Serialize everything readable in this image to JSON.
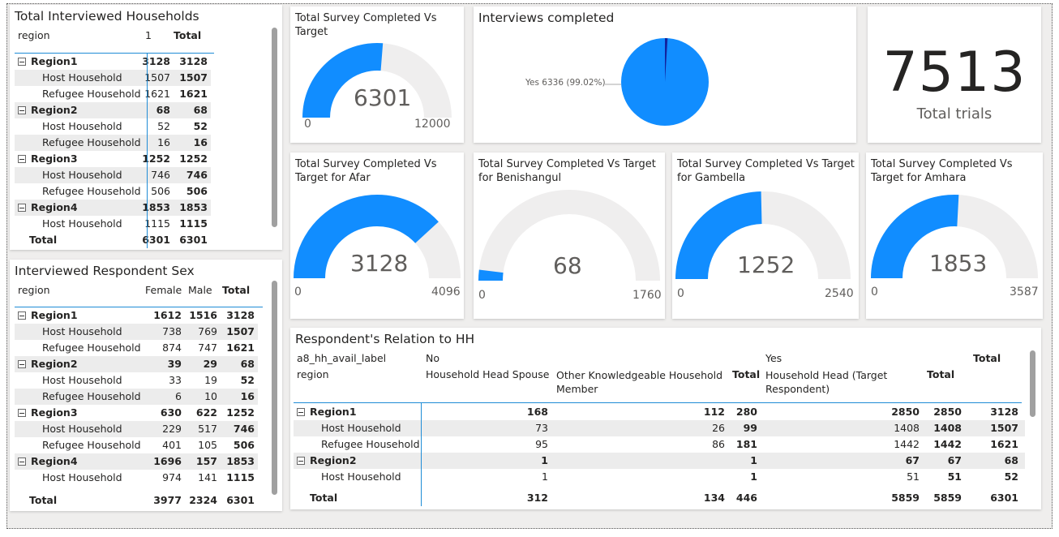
{
  "colors": {
    "accent": "#118dff",
    "track": "#efeeee",
    "dark": "#12239e"
  },
  "households": {
    "title": "Total Interviewed Households",
    "headers": [
      "region",
      "1",
      "Total"
    ],
    "rows": [
      {
        "label": "Region1",
        "v1": "3128",
        "total": "3128",
        "level": 0
      },
      {
        "label": "Host Household",
        "v1": "1507",
        "total": "1507",
        "level": 1
      },
      {
        "label": "Refugee Household",
        "v1": "1621",
        "total": "1621",
        "level": 1
      },
      {
        "label": "Region2",
        "v1": "68",
        "total": "68",
        "level": 0
      },
      {
        "label": "Host Household",
        "v1": "52",
        "total": "52",
        "level": 1
      },
      {
        "label": "Refugee Household",
        "v1": "16",
        "total": "16",
        "level": 1
      },
      {
        "label": "Region3",
        "v1": "1252",
        "total": "1252",
        "level": 0
      },
      {
        "label": "Host Household",
        "v1": "746",
        "total": "746",
        "level": 1
      },
      {
        "label": "Refugee Household",
        "v1": "506",
        "total": "506",
        "level": 1
      },
      {
        "label": "Region4",
        "v1": "1853",
        "total": "1853",
        "level": 0
      },
      {
        "label": "Host Household",
        "v1": "1115",
        "total": "1115",
        "level": 1
      }
    ],
    "total": {
      "label": "Total",
      "v1": "6301",
      "total": "6301"
    }
  },
  "sex": {
    "title": "Interviewed Respondent Sex",
    "headers": [
      "region",
      "Female",
      "Male",
      "Total"
    ],
    "rows": [
      {
        "label": "Region1",
        "f": "1612",
        "m": "1516",
        "t": "3128",
        "level": 0
      },
      {
        "label": "Host Household",
        "f": "738",
        "m": "769",
        "t": "1507",
        "level": 1
      },
      {
        "label": "Refugee Household",
        "f": "874",
        "m": "747",
        "t": "1621",
        "level": 1
      },
      {
        "label": "Region2",
        "f": "39",
        "m": "29",
        "t": "68",
        "level": 0
      },
      {
        "label": "Host Household",
        "f": "33",
        "m": "19",
        "t": "52",
        "level": 1
      },
      {
        "label": "Refugee Household",
        "f": "6",
        "m": "10",
        "t": "16",
        "level": 1
      },
      {
        "label": "Region3",
        "f": "630",
        "m": "622",
        "t": "1252",
        "level": 0
      },
      {
        "label": "Host Household",
        "f": "229",
        "m": "517",
        "t": "746",
        "level": 1
      },
      {
        "label": "Refugee Household",
        "f": "401",
        "m": "105",
        "t": "506",
        "level": 1
      },
      {
        "label": "Region4",
        "f": "1696",
        "m": "157",
        "t": "1853",
        "level": 0
      },
      {
        "label": "Host Household",
        "f": "974",
        "m": "141",
        "t": "1115",
        "level": 1
      }
    ],
    "total": {
      "label": "Total",
      "f": "3977",
      "m": "2324",
      "t": "6301"
    }
  },
  "gauge_main": {
    "title": "Total Survey Completed Vs Target",
    "value": "6301",
    "min": "0",
    "max": "12000",
    "fraction": 0.525
  },
  "gauge_afar": {
    "title": "Total Survey Completed Vs Target for Afar",
    "value": "3128",
    "min": "0",
    "max": "4096",
    "fraction": 0.7637
  },
  "gauge_beni": {
    "title": "Total Survey Completed Vs Target for Benishangul",
    "value": "68",
    "min": "0",
    "max": "1760",
    "fraction": 0.0386
  },
  "gauge_gamb": {
    "title": "Total Survey Completed Vs Target for Gambella",
    "value": "1252",
    "min": "0",
    "max": "2540",
    "fraction": 0.4929
  },
  "gauge_amha": {
    "title": "Total Survey Completed Vs Target for Amhara",
    "value": "1853",
    "min": "0",
    "max": "3587",
    "fraction": 0.5166
  },
  "pie": {
    "title": "Interviews completed",
    "label": "Yes 6336 (99.02%)"
  },
  "card": {
    "value": "7513",
    "label": "Total trials"
  },
  "relation": {
    "title": "Respondent's Relation to HH",
    "h_field": "a8_hh_avail_label",
    "h_no": "No",
    "h_yes": "Yes",
    "h_total": "Total",
    "h_region": "region",
    "h_spouse": "Household Head Spouse",
    "h_other": "Other Knowledgeable Household Member",
    "h_no_total": "Total",
    "h_head": "Household Head (Target Respondent)",
    "h_yes_total": "Total",
    "rows": [
      {
        "label": "Region1",
        "spouse": "168",
        "other": "112",
        "nt": "280",
        "head": "2850",
        "yt": "2850",
        "t": "3128",
        "level": 0
      },
      {
        "label": "Host Household",
        "spouse": "73",
        "other": "26",
        "nt": "99",
        "head": "1408",
        "yt": "1408",
        "t": "1507",
        "level": 1
      },
      {
        "label": "Refugee Household",
        "spouse": "95",
        "other": "86",
        "nt": "181",
        "head": "1442",
        "yt": "1442",
        "t": "1621",
        "level": 1
      },
      {
        "label": "Region2",
        "spouse": "1",
        "other": "",
        "nt": "1",
        "head": "67",
        "yt": "67",
        "t": "68",
        "level": 0
      },
      {
        "label": "Host Household",
        "spouse": "1",
        "other": "",
        "nt": "1",
        "head": "51",
        "yt": "51",
        "t": "52",
        "level": 1
      }
    ],
    "total": {
      "label": "Total",
      "spouse": "312",
      "other": "134",
      "nt": "446",
      "head": "5859",
      "yt": "5859",
      "t": "6301"
    }
  }
}
